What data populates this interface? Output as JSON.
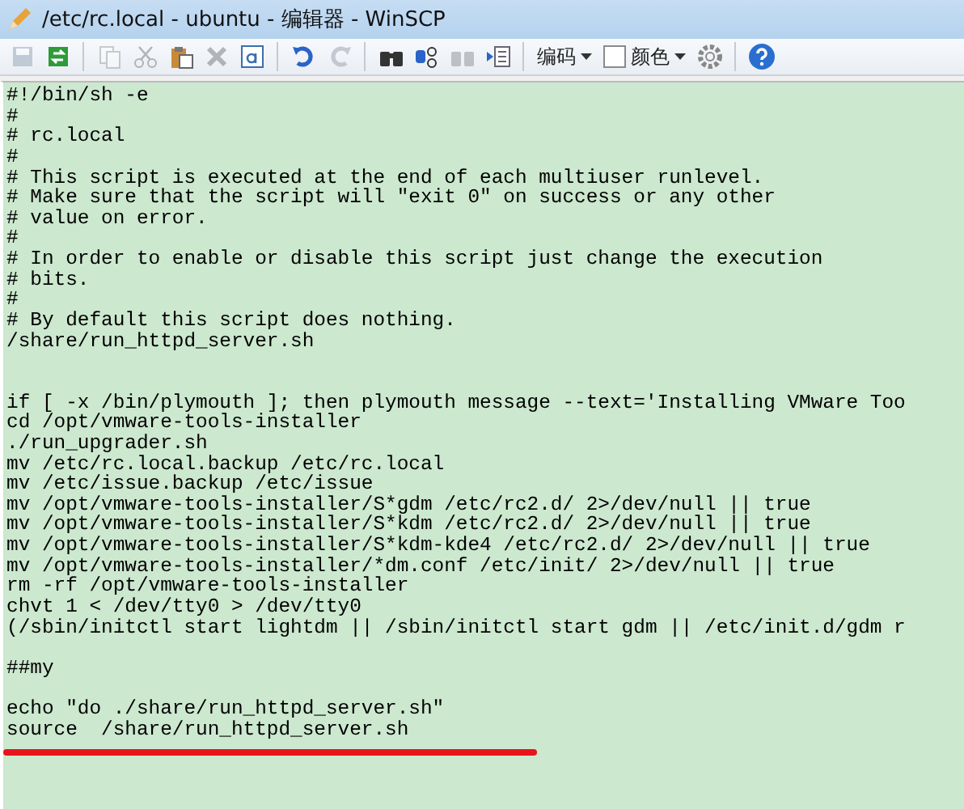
{
  "window": {
    "title": "/etc/rc.local - ubuntu - 编辑器 - WinSCP"
  },
  "toolbar": {
    "groups": [
      [
        {
          "disabled": true
        },
        {
          "disabled": false
        }
      ],
      [
        {
          "disabled": true
        },
        {
          "disabled": true
        },
        {
          "disabled": false
        },
        {
          "disabled": true
        },
        {
          "disabled": false
        }
      ],
      [
        {
          "disabled": false
        },
        {
          "disabled": true
        }
      ],
      [
        {
          "disabled": false
        },
        {
          "disabled": false
        },
        {
          "disabled": true
        },
        {
          "disabled": false
        }
      ]
    ],
    "encoding": {
      "label": "编码"
    },
    "color": {
      "label": "颜色",
      "checked": false
    }
  },
  "editor": {
    "lines": [
      "#!/bin/sh -e",
      "#",
      "# rc.local",
      "#",
      "# This script is executed at the end of each multiuser runlevel.",
      "# Make sure that the script will \"exit 0\" on success or any other",
      "# value on error.",
      "#",
      "# In order to enable or disable this script just change the execution",
      "# bits.",
      "#",
      "# By default this script does nothing.",
      "/share/run_httpd_server.sh",
      {
        "kind": "blank"
      },
      {
        "kind": "blank"
      },
      "if [ -x /bin/plymouth ]; then plymouth message --text='Installing VMware Too",
      "cd /opt/vmware-tools-installer",
      "./run_upgrader.sh",
      "mv /etc/rc.local.backup /etc/rc.local",
      "mv /etc/issue.backup /etc/issue",
      "mv /opt/vmware-tools-installer/S*gdm /etc/rc2.d/ 2>/dev/null || true",
      "mv /opt/vmware-tools-installer/S*kdm /etc/rc2.d/ 2>/dev/null || true",
      "mv /opt/vmware-tools-installer/S*kdm-kde4 /etc/rc2.d/ 2>/dev/null || true",
      "mv /opt/vmware-tools-installer/*dm.conf /etc/init/ 2>/dev/null || true",
      "rm -rf /opt/vmware-tools-installer",
      "chvt 1 < /dev/tty0 > /dev/tty0",
      "(/sbin/initctl start lightdm || /sbin/initctl start gdm || /etc/init.d/gdm r",
      {
        "kind": "blank"
      },
      "##my",
      {
        "kind": "blank"
      },
      "echo \"do ./share/run_httpd_server.sh\"",
      "source  /share/run_httpd_server.sh"
    ],
    "annotation": {
      "kind": "underline"
    }
  }
}
